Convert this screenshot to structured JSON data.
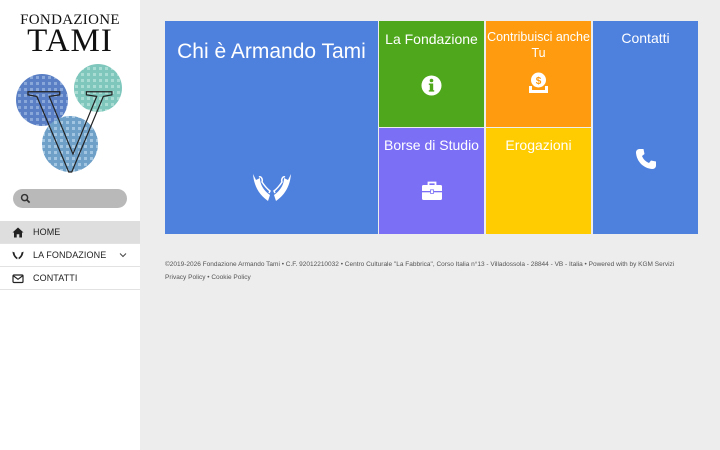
{
  "logo": {
    "line1": "FONDAZIONE",
    "line2": "TAMI",
    "monogram": "V"
  },
  "search": {
    "placeholder": "",
    "value": ""
  },
  "nav": {
    "items": [
      {
        "label": "HOME",
        "icon": "home-icon",
        "active": true
      },
      {
        "label": "LA FONDAZIONE",
        "icon": "hands-icon",
        "expandable": true
      },
      {
        "label": "CONTATTI",
        "icon": "envelope-icon"
      }
    ]
  },
  "tiles": {
    "chi": {
      "label": "Chi è Armando Tami",
      "icon": "hands-icon",
      "color": "#4e80de"
    },
    "fondazione": {
      "label": "La Fondazione",
      "icon": "info-icon",
      "color": "#4fa81c"
    },
    "contribuisci": {
      "label": "Contribuisci anche Tu",
      "icon": "donation-icon",
      "color": "#fe9b0f"
    },
    "contatti": {
      "label": "Contatti",
      "icon": "phone-icon",
      "color": "#4e80de"
    },
    "borse": {
      "label": "Borse di Studio",
      "icon": "briefcase-icon",
      "color": "#7b6ff6"
    },
    "erogazioni": {
      "label": "Erogazioni",
      "color": "#fecc00"
    }
  },
  "footer": {
    "line1": "©2019-2026 Fondazione Armando Tami • C.F. 92012210032 • Centro Culturale \"La Fabbrica\", Corso Italia n°13 - Villadossola - 28844 - VB - Italia • Powered with by KGM Servizi",
    "privacy": "Privacy Policy",
    "separator": " • ",
    "cookie": "Cookie Policy"
  }
}
